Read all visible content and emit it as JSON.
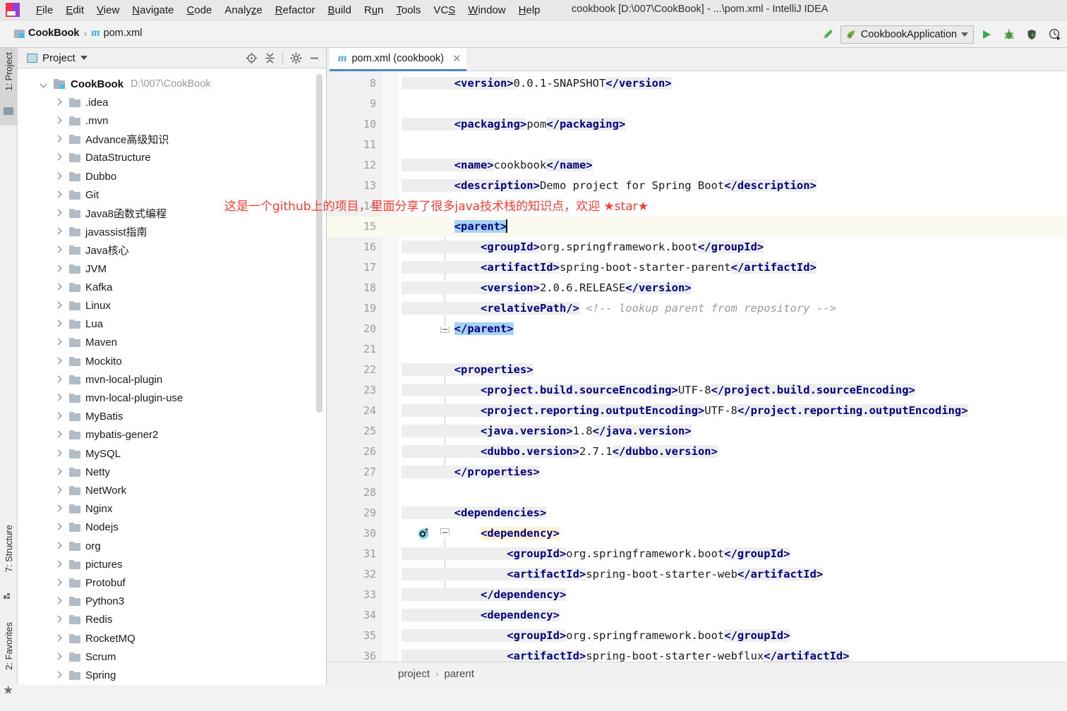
{
  "window": {
    "title": "cookbook [D:\\007\\CookBook] - ...\\pom.xml - IntelliJ IDEA",
    "logo_icon": "intellij-idea-logo"
  },
  "menubar": {
    "items": [
      {
        "label": "File",
        "mnemonic": "F"
      },
      {
        "label": "Edit",
        "mnemonic": "E"
      },
      {
        "label": "View",
        "mnemonic": "V"
      },
      {
        "label": "Navigate",
        "mnemonic": "N"
      },
      {
        "label": "Code",
        "mnemonic": "C"
      },
      {
        "label": "Analyze",
        "mnemonic": "z"
      },
      {
        "label": "Refactor",
        "mnemonic": "R"
      },
      {
        "label": "Build",
        "mnemonic": "B"
      },
      {
        "label": "Run",
        "mnemonic": "u"
      },
      {
        "label": "Tools",
        "mnemonic": "T"
      },
      {
        "label": "VCS",
        "mnemonic": "S"
      },
      {
        "label": "Window",
        "mnemonic": "W"
      },
      {
        "label": "Help",
        "mnemonic": "H"
      }
    ]
  },
  "navbar": {
    "breadcrumb": [
      {
        "label": "CookBook",
        "icon": "project-module-icon"
      },
      {
        "label": "pom.xml",
        "icon": "maven-m-icon"
      }
    ],
    "separator": "›",
    "run_config": {
      "label": "CookbookApplication",
      "icon": "spring-boot-leaf-icon",
      "chevron": "chevron-down-icon"
    },
    "buttons": [
      {
        "name": "build-project-button",
        "icon": "hammer-icon"
      },
      {
        "name": "run-button",
        "icon": "play-icon"
      },
      {
        "name": "debug-button",
        "icon": "bug-icon"
      },
      {
        "name": "run-with-coverage-button",
        "icon": "coverage-icon"
      },
      {
        "name": "profiler-button",
        "icon": "profiler-clock-icon"
      }
    ]
  },
  "left_strip": {
    "project_button": "1: Project",
    "structure_button": "7: Structure",
    "favorites_button": "2: Favorites"
  },
  "project_panel": {
    "title": "Project",
    "title_icon": "project-view-icon",
    "dropdown_icon": "chevron-down-icon",
    "actions": [
      {
        "name": "select-opened-file-button",
        "icon": "crosshair-target-icon"
      },
      {
        "name": "collapse-all-button",
        "icon": "collapse-all-icon"
      },
      {
        "name": "settings-button",
        "icon": "gear-icon"
      },
      {
        "name": "hide-button",
        "icon": "minimize-icon"
      }
    ],
    "root": {
      "label": "CookBook",
      "path": "D:\\007\\CookBook",
      "expanded": true,
      "icon": "project-module-icon"
    },
    "children": [
      {
        "label": ".idea",
        "icon": "folder-icon"
      },
      {
        "label": ".mvn",
        "icon": "folder-icon"
      },
      {
        "label": "Advance高级知识",
        "icon": "folder-icon"
      },
      {
        "label": "DataStructure",
        "icon": "folder-icon"
      },
      {
        "label": "Dubbo",
        "icon": "folder-icon"
      },
      {
        "label": "Git",
        "icon": "folder-icon"
      },
      {
        "label": "Java8函数式编程",
        "icon": "folder-icon"
      },
      {
        "label": "javassist指南",
        "icon": "folder-icon"
      },
      {
        "label": "Java核心",
        "icon": "folder-icon"
      },
      {
        "label": "JVM",
        "icon": "folder-icon"
      },
      {
        "label": "Kafka",
        "icon": "folder-icon"
      },
      {
        "label": "Linux",
        "icon": "folder-icon"
      },
      {
        "label": "Lua",
        "icon": "folder-icon"
      },
      {
        "label": "Maven",
        "icon": "folder-icon"
      },
      {
        "label": "Mockito",
        "icon": "folder-icon"
      },
      {
        "label": "mvn-local-plugin",
        "icon": "folder-icon"
      },
      {
        "label": "mvn-local-plugin-use",
        "icon": "folder-icon"
      },
      {
        "label": "MyBatis",
        "icon": "folder-icon"
      },
      {
        "label": "mybatis-gener2",
        "icon": "folder-icon"
      },
      {
        "label": "MySQL",
        "icon": "folder-icon"
      },
      {
        "label": "Netty",
        "icon": "folder-icon"
      },
      {
        "label": "NetWork",
        "icon": "folder-icon"
      },
      {
        "label": "Nginx",
        "icon": "folder-icon"
      },
      {
        "label": "Nodejs",
        "icon": "folder-icon"
      },
      {
        "label": "org",
        "icon": "folder-icon"
      },
      {
        "label": "pictures",
        "icon": "folder-icon"
      },
      {
        "label": "Protobuf",
        "icon": "folder-icon"
      },
      {
        "label": "Python3",
        "icon": "folder-icon"
      },
      {
        "label": "Redis",
        "icon": "folder-icon"
      },
      {
        "label": "RocketMQ",
        "icon": "folder-icon"
      },
      {
        "label": "Scrum",
        "icon": "folder-icon"
      },
      {
        "label": "Spring",
        "icon": "folder-icon"
      }
    ]
  },
  "editor": {
    "tab": {
      "label": "pom.xml (cookbook)",
      "icon": "maven-m-icon",
      "close_icon": "close-icon",
      "active": true
    },
    "annotation_overlay": "这是一个github上的项目，里面分享了很多java技术栈的知识点，欢迎 ★star★",
    "annotation_color": "#fb3b34",
    "breadcrumb": [
      "project",
      "parent"
    ],
    "breadcrumb_separator": "›",
    "lines": [
      {
        "num": 8,
        "segs": [
          {
            "t": "tag",
            "v": "        <version>"
          },
          {
            "t": "val",
            "v": "0.0.1-SNAPSHOT"
          },
          {
            "t": "tag",
            "v": "</version>"
          }
        ]
      },
      {
        "num": 9,
        "segs": []
      },
      {
        "num": 10,
        "segs": [
          {
            "t": "tag",
            "v": "        <packaging>"
          },
          {
            "t": "val",
            "v": "pom"
          },
          {
            "t": "tag",
            "v": "</packaging>"
          }
        ]
      },
      {
        "num": 11,
        "segs": []
      },
      {
        "num": 12,
        "segs": [
          {
            "t": "tag",
            "v": "        <name>"
          },
          {
            "t": "val",
            "v": "cookbook"
          },
          {
            "t": "tag",
            "v": "</name>"
          }
        ]
      },
      {
        "num": 13,
        "segs": [
          {
            "t": "tag",
            "v": "        <description>"
          },
          {
            "t": "val",
            "v": "Demo project for Spring Boot"
          },
          {
            "t": "tag",
            "v": "</description>"
          }
        ]
      },
      {
        "num": 14,
        "segs": []
      },
      {
        "num": 15,
        "current": true,
        "fold": "start",
        "bulb": true,
        "segs": [
          {
            "t": "plain",
            "v": "        "
          },
          {
            "t": "tagsel",
            "v": "<parent>"
          },
          {
            "t": "caret",
            "v": ""
          }
        ]
      },
      {
        "num": 16,
        "segs": [
          {
            "t": "tag",
            "v": "            <groupId>"
          },
          {
            "t": "val",
            "v": "org.springframework.boot"
          },
          {
            "t": "tag",
            "v": "</groupId>"
          }
        ]
      },
      {
        "num": 17,
        "segs": [
          {
            "t": "tag",
            "v": "            <artifactId>"
          },
          {
            "t": "val",
            "v": "spring-boot-starter-parent"
          },
          {
            "t": "tag",
            "v": "</artifactId>"
          }
        ]
      },
      {
        "num": 18,
        "segs": [
          {
            "t": "tag",
            "v": "            <version>"
          },
          {
            "t": "val",
            "v": "2.0.6.RELEASE"
          },
          {
            "t": "tag",
            "v": "</version>"
          }
        ]
      },
      {
        "num": 19,
        "segs": [
          {
            "t": "tag",
            "v": "            <relativePath/>"
          },
          {
            "t": "plain",
            "v": " "
          },
          {
            "t": "cmt",
            "v": "<!-- lookup parent from repository -->"
          }
        ]
      },
      {
        "num": 20,
        "fold": "end",
        "segs": [
          {
            "t": "plain",
            "v": "        "
          },
          {
            "t": "tagsel",
            "v": "</parent>"
          }
        ]
      },
      {
        "num": 21,
        "segs": []
      },
      {
        "num": 22,
        "fold": "start",
        "segs": [
          {
            "t": "tag",
            "v": "        <properties>"
          }
        ]
      },
      {
        "num": 23,
        "segs": [
          {
            "t": "tag",
            "v": "            <project.build.sourceEncoding>"
          },
          {
            "t": "val",
            "v": "UTF-8"
          },
          {
            "t": "tag",
            "v": "</project.build.sourceEncoding>"
          }
        ]
      },
      {
        "num": 24,
        "segs": [
          {
            "t": "tag",
            "v": "            <project.reporting.outputEncoding>"
          },
          {
            "t": "val",
            "v": "UTF-8"
          },
          {
            "t": "tag",
            "v": "</project.reporting.outputEncoding>"
          }
        ]
      },
      {
        "num": 25,
        "segs": [
          {
            "t": "tag",
            "v": "            <java.version>"
          },
          {
            "t": "val",
            "v": "1.8"
          },
          {
            "t": "tag",
            "v": "</java.version>"
          }
        ]
      },
      {
        "num": 26,
        "segs": [
          {
            "t": "tag",
            "v": "            <dubbo.version>"
          },
          {
            "t": "val",
            "v": "2.7.1"
          },
          {
            "t": "tag",
            "v": "</dubbo.version>"
          }
        ]
      },
      {
        "num": 27,
        "fold": "end",
        "segs": [
          {
            "t": "tag",
            "v": "        </properties>"
          }
        ]
      },
      {
        "num": 28,
        "segs": []
      },
      {
        "num": 29,
        "fold": "start",
        "segs": [
          {
            "t": "tag",
            "v": "        <dependencies>"
          }
        ]
      },
      {
        "num": 30,
        "fold": "start",
        "dep_icon": true,
        "segs": [
          {
            "t": "plain",
            "v": "            "
          },
          {
            "t": "taghl",
            "v": "<dependency>"
          }
        ]
      },
      {
        "num": 31,
        "segs": [
          {
            "t": "tag",
            "v": "                <groupId>"
          },
          {
            "t": "val",
            "v": "org.springframework.boot"
          },
          {
            "t": "tag",
            "v": "</groupId>"
          }
        ]
      },
      {
        "num": 32,
        "segs": [
          {
            "t": "tag",
            "v": "                <artifactId>"
          },
          {
            "t": "val",
            "v": "spring-boot-starter-web"
          },
          {
            "t": "tag",
            "v": "</artifactId>"
          }
        ]
      },
      {
        "num": 33,
        "fold": "end",
        "segs": [
          {
            "t": "tag",
            "v": "            </dependency>"
          }
        ]
      },
      {
        "num": 34,
        "fold": "start",
        "dep_icon": true,
        "segs": [
          {
            "t": "tag",
            "v": "            <dependency>"
          }
        ]
      },
      {
        "num": 35,
        "segs": [
          {
            "t": "tag",
            "v": "                <groupId>"
          },
          {
            "t": "val",
            "v": "org.springframework.boot"
          },
          {
            "t": "tag",
            "v": "</groupId>"
          }
        ]
      },
      {
        "num": 36,
        "segs": [
          {
            "t": "tag",
            "v": "                <artifactId>"
          },
          {
            "t": "val",
            "v": "spring-boot-starter-webflux"
          },
          {
            "t": "tag",
            "v": "</artifactId>"
          }
        ]
      }
    ]
  },
  "colors": {
    "accent_blue": "#4b86c7",
    "tag_navy": "#000080",
    "selection_blue": "#a6d2f5",
    "current_line": "#fcfaef",
    "annotation_red": "#fb3b34",
    "run_green": "#3aa757"
  }
}
